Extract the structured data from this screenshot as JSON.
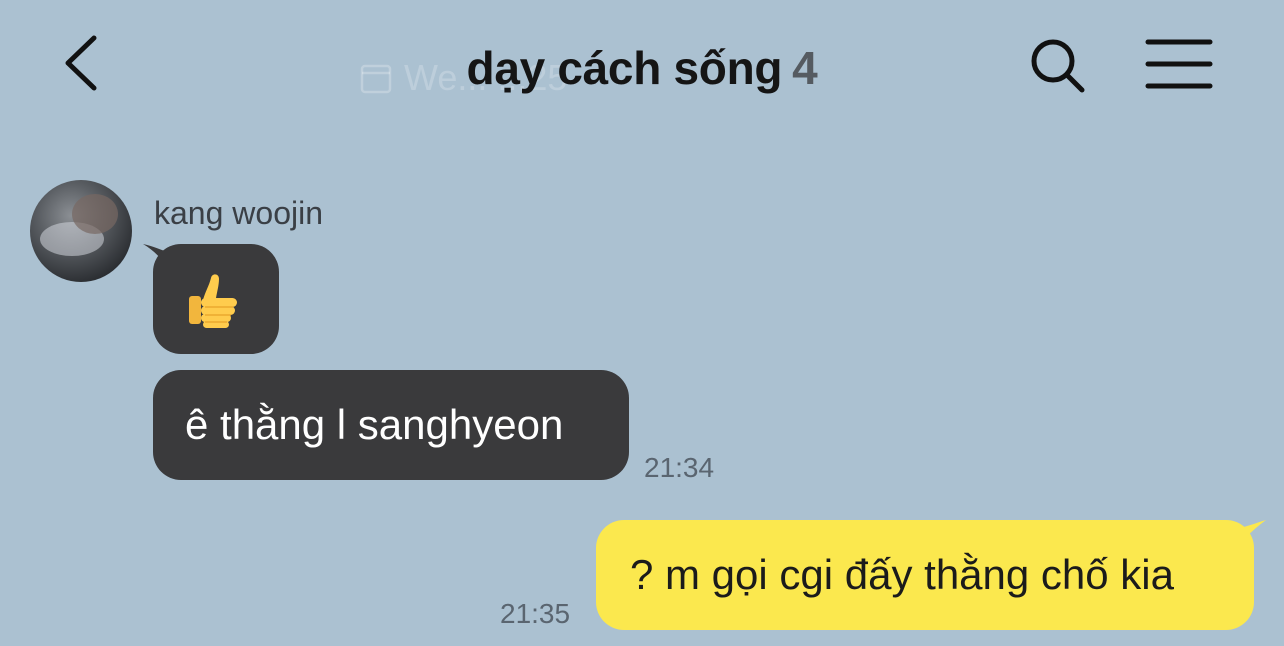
{
  "header": {
    "title": "dạy cách sống",
    "member_count": "4",
    "date_overlay": "We...  ...25",
    "back_icon": "chevron-left-icon",
    "search_icon": "search-icon",
    "menu_icon": "hamburger-menu-icon"
  },
  "messages": [
    {
      "sender": "kang woojin",
      "bubbles": [
        {
          "type": "emoji",
          "content": "thumbs-up-emoji"
        },
        {
          "type": "text",
          "content": "ê thằng l sanghyeon"
        }
      ],
      "time": "21:34"
    },
    {
      "sender": "me",
      "bubbles": [
        {
          "type": "text",
          "content": "? m gọi cgi đấy thằng chố kia"
        }
      ],
      "time": "21:35"
    }
  ],
  "colors": {
    "background": "#abc1d1",
    "incoming_bubble": "#3a3a3c",
    "outgoing_bubble": "#fbe84e"
  }
}
